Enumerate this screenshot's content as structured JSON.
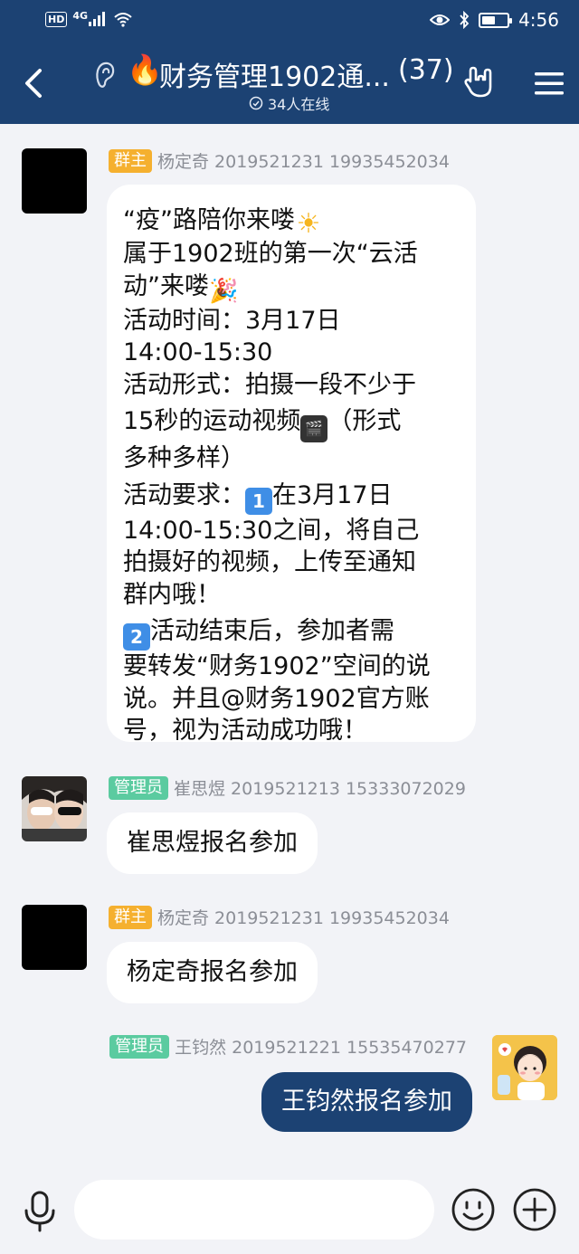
{
  "status_bar": {
    "hd": "HD",
    "network": "4G",
    "time": "4:56"
  },
  "header": {
    "title_emoji": "🔥",
    "title": "财务管理1902通...",
    "member_count": "(37)",
    "online": "34人在线"
  },
  "messages": [
    {
      "role": "群主",
      "sender": "杨定奇 2019521231 19935452034",
      "lines": [
        "“疫”路陪你来喽",
        "属于1902班的第一次“云活",
        "动”来喽",
        "活动时间：3月17日",
        "14:00-15:30",
        "活动形式：拍摄一段不少于",
        "15秒的运动视频",
        "（形式",
        "多种多样）",
        "活动要求：",
        "在3月17日",
        "14:00-15:30之间，将自己",
        "拍摄好的视频，上传至通知",
        "群内哦！",
        "活动结束后，参加者需",
        "要转发“财务1902”空间的说",
        "说。并且@财务1902官方账",
        "号，视为活动成功哦！"
      ]
    },
    {
      "role": "管理员",
      "sender": "崔思煜 2019521213 15333072029",
      "text": "崔思煜报名参加"
    },
    {
      "role": "群主",
      "sender": "杨定奇 2019521231 19935452034",
      "text": "杨定奇报名参加"
    },
    {
      "role": "管理员",
      "sender": "王钧然 2019521221 15535470277",
      "text": "王钧然报名参加"
    }
  ],
  "icons": {
    "sun": "☀",
    "party": "🎉",
    "clapper": "🎬",
    "keycap_1": "1",
    "keycap_2": "2"
  },
  "colors": {
    "header_bg": "#1c4273",
    "owner_badge": "#f5b02f",
    "admin_badge": "#5bcba0",
    "self_bubble": "#1c4273",
    "page_bg": "#f2f3f7"
  },
  "battery_level": 0.55
}
